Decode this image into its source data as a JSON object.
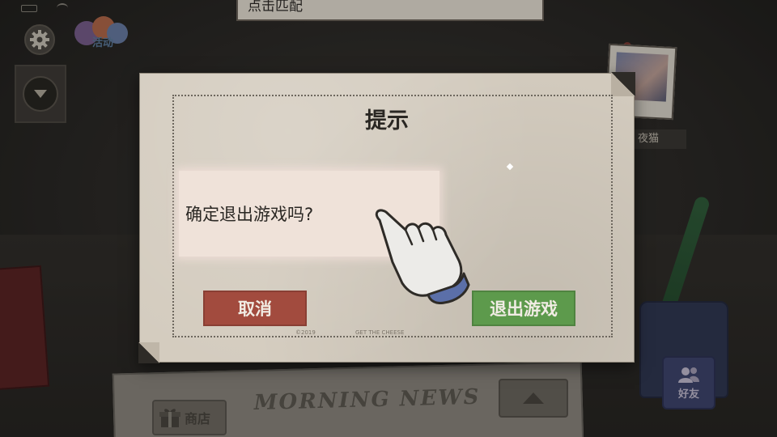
{
  "top_banner": {
    "text": "点击匹配"
  },
  "hud": {
    "event_label": "活动",
    "cat_label": "夜猫",
    "shop_label": "商店",
    "friends_label": "好友",
    "newspaper_masthead": "MORNING NEWS"
  },
  "dialog": {
    "title": "提示",
    "message": "确定退出游戏吗?",
    "cancel_label": "取消",
    "exit_label": "退出游戏",
    "footer_left": "©2019",
    "footer_mid": "GET THE CHEESE"
  },
  "colors": {
    "cancel": "#a24b3e",
    "exit": "#5d9a4c",
    "paper": "#d4ccbf"
  },
  "icons": [
    "settings-gear-icon",
    "event-icon",
    "expand-down-icon",
    "shop-gift-icon",
    "friends-icon",
    "up-arrow-icon",
    "pointing-hand-icon"
  ]
}
